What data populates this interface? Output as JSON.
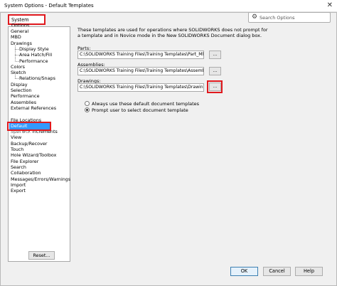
{
  "window": {
    "title": "System Options - Default Templates",
    "close_glyph": "✕"
  },
  "tab": {
    "label": "System Options"
  },
  "search": {
    "placeholder": "Search Options",
    "icon": "gear-icon"
  },
  "sidebar": {
    "items": [
      {
        "label": "General",
        "indent": 0
      },
      {
        "label": "MBD",
        "indent": 0
      },
      {
        "label": "Drawings",
        "indent": 0
      },
      {
        "label": "Display Style",
        "indent": 1
      },
      {
        "label": "Area Hatch/Fill",
        "indent": 1
      },
      {
        "label": "Performance",
        "indent": 1
      },
      {
        "label": "Colors",
        "indent": 0
      },
      {
        "label": "Sketch",
        "indent": 0
      },
      {
        "label": "Relations/Snaps",
        "indent": 1
      },
      {
        "label": "Display",
        "indent": 0
      },
      {
        "label": "Selection",
        "indent": 0
      },
      {
        "label": "Performance",
        "indent": 0
      },
      {
        "label": "Assemblies",
        "indent": 0
      },
      {
        "label": "External References",
        "indent": 0
      },
      {
        "label": "Default Templates",
        "indent": 0,
        "selected": true
      },
      {
        "label": "File Locations",
        "indent": 0
      },
      {
        "label": "FeatureManager",
        "indent": 0
      },
      {
        "label": "Spin Box Increments",
        "indent": 0
      },
      {
        "label": "View",
        "indent": 0
      },
      {
        "label": "Backup/Recover",
        "indent": 0
      },
      {
        "label": "Touch",
        "indent": 0
      },
      {
        "label": "Hole Wizard/Toolbox",
        "indent": 0
      },
      {
        "label": "File Explorer",
        "indent": 0
      },
      {
        "label": "Search",
        "indent": 0
      },
      {
        "label": "Collaboration",
        "indent": 0
      },
      {
        "label": "Messages/Errors/Warnings",
        "indent": 0
      },
      {
        "label": "Import",
        "indent": 0
      },
      {
        "label": "Export",
        "indent": 0
      }
    ],
    "reset_label": "Reset..."
  },
  "main": {
    "description": "These templates are used for operations where SOLIDWORKS does not prompt for a template and in Novice mode in the New SOLIDWORKS Document dialog box.",
    "parts": {
      "label": "Parts:",
      "value": "C:\\SOLIDWORKS Training Files\\Training Templates\\Part_MM.prt",
      "browse": "..."
    },
    "assemblies": {
      "label": "Assemblies:",
      "value": "C:\\SOLIDWORKS Training Files\\Training Templates\\Assembly_MI",
      "browse": "..."
    },
    "drawings": {
      "label": "Drawings:",
      "value": "C:\\SOLIDWORKS Training Files\\Training Templates\\Drawing_AN",
      "browse": "..."
    },
    "radio_always": "Always use these default document templates",
    "radio_prompt": "Prompt user to select document template",
    "selected_radio": "prompt"
  },
  "footer": {
    "ok": "OK",
    "cancel": "Cancel",
    "help": "Help"
  },
  "colors": {
    "highlight_red": "#e0191e",
    "selection_blue": "#3399ff"
  }
}
